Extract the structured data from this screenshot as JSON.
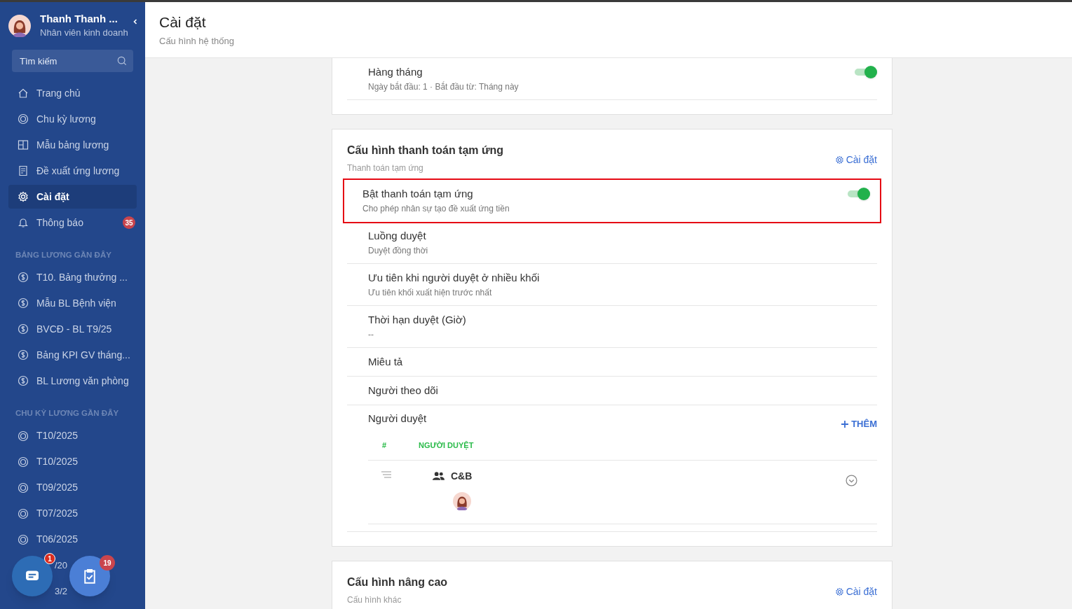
{
  "sidebar": {
    "user": {
      "name": "Thanh Thanh ...",
      "role": "Nhân viên kinh doanh"
    },
    "search": {
      "placeholder": "Tìm kiếm"
    },
    "nav": [
      {
        "label": "Trang chủ",
        "selected": false
      },
      {
        "label": "Chu kỳ lương",
        "selected": false
      },
      {
        "label": "Mẫu bảng lương",
        "selected": false
      },
      {
        "label": "Đề xuất ứng lương",
        "selected": false
      },
      {
        "label": "Cài đặt",
        "selected": true
      },
      {
        "label": "Thông báo",
        "selected": false,
        "badge": "35"
      }
    ],
    "sections": [
      {
        "title": "BẢNG LƯƠNG GẦN ĐÂY",
        "items": [
          {
            "label": "T10. Bảng thưởng ..."
          },
          {
            "label": "Mẫu BL Bệnh viện"
          },
          {
            "label": "BVCĐ - BL T9/25"
          },
          {
            "label": "Bảng KPI GV tháng..."
          },
          {
            "label": "BL Lương văn phòng"
          }
        ]
      },
      {
        "title": "CHU KỲ LƯƠNG GẦN ĐÂY",
        "items": [
          {
            "label": "T10/2025"
          },
          {
            "label": "T10/2025"
          },
          {
            "label": "T09/2025"
          },
          {
            "label": "T07/2025"
          },
          {
            "label": "T06/2025"
          },
          {
            "label": "/20",
            "kind": "partial"
          },
          {
            "label": "3/2",
            "kind": "partial"
          }
        ]
      }
    ]
  },
  "fabs": [
    {
      "badge": "1"
    },
    {
      "badge": "19"
    }
  ],
  "header": {
    "title": "Cài đặt",
    "subtitle": "Cấu hình hệ thống"
  },
  "cards": [
    {
      "rows": [
        {
          "kind": "toggle",
          "label": "Hàng tháng",
          "sub": "Ngày bắt đầu: 1 · Bắt đầu từ: Tháng này",
          "on": true,
          "highlighted": false
        }
      ]
    },
    {
      "title": "Cấu hình thanh toán tạm ứng",
      "subtitle": "Thanh toán tạm ứng",
      "action": "Cài đặt",
      "rows": [
        {
          "kind": "toggle",
          "label": "Bật thanh toán tạm ứng",
          "sub": "Cho phép nhân sự tạo đề xuất ứng tiền",
          "on": true,
          "highlighted": true
        },
        {
          "kind": "text",
          "label": "Luồng duyệt",
          "sub": "Duyệt đồng thời"
        },
        {
          "kind": "text",
          "label": "Ưu tiên khi người duyệt ở nhiều khối",
          "sub": "Ưu tiên khối xuất hiện trước nhất"
        },
        {
          "kind": "text",
          "label": "Thời hạn duyệt (Giờ)",
          "sub": "--"
        },
        {
          "kind": "text",
          "label": "Miêu tả"
        },
        {
          "kind": "text",
          "label": "Người theo dõi"
        },
        {
          "kind": "approvers",
          "label": "Người duyệt",
          "add": "THÊM",
          "columns": [
            "#",
            "NGƯỜI DUYỆT"
          ],
          "items": [
            {
              "name": "C&B"
            }
          ]
        }
      ]
    },
    {
      "title": "Cấu hình nâng cao",
      "subtitle": "Cấu hình khác",
      "action": "Cài đặt"
    }
  ]
}
